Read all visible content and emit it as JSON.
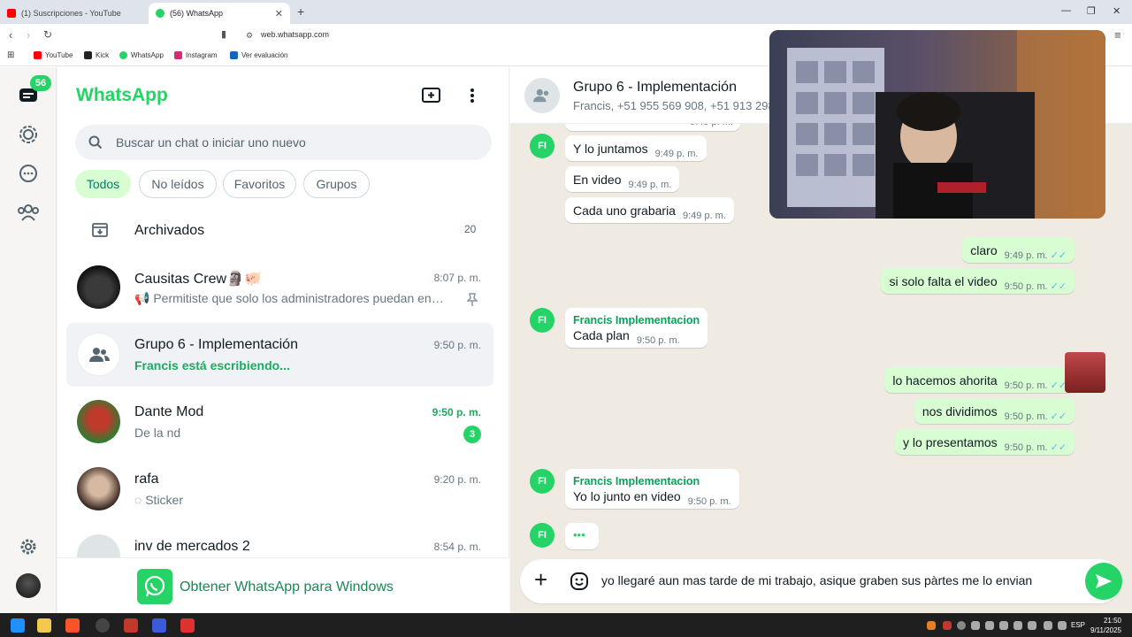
{
  "browser": {
    "tabs": [
      {
        "title": "(1) Suscripciones - YouTube",
        "active": false
      },
      {
        "title": "(56) WhatsApp",
        "active": true
      }
    ],
    "url": "web.whatsapp.com",
    "bookmarks": [
      "YouTube",
      "Kick",
      "WhatsApp",
      "Instagram",
      "Ver evaluación"
    ]
  },
  "rail": {
    "chats_badge": "56"
  },
  "sidebar": {
    "title": "WhatsApp",
    "search_placeholder": "Buscar un chat o iniciar uno nuevo",
    "filters": [
      "Todos",
      "No leídos",
      "Favoritos",
      "Grupos"
    ],
    "archived": {
      "label": "Archivados",
      "count": "20"
    },
    "chats": [
      {
        "name": "Causitas Crew🗿🐖",
        "time": "8:07 p. m.",
        "preview": "📢 Permitiste que solo los administradores puedan enviar...",
        "pinned": true
      },
      {
        "name": "Grupo 6 - Implementación",
        "time": "9:50 p. m.",
        "preview": "Francis está escribiendo..."
      },
      {
        "name": "Dante Mod",
        "time": "9:50 p. m.",
        "preview": "De la nd",
        "unread": "3"
      },
      {
        "name": "rafa",
        "time": "9:20 p. m.",
        "preview": "Sticker"
      },
      {
        "name": "inv de mercados 2",
        "time": "8:54 p. m.",
        "preview": ""
      }
    ],
    "get_app": "Obtener WhatsApp para Windows"
  },
  "conversation": {
    "name": "Grupo 6 - Implementación",
    "members": "Francis, +51 955 569 908, +51 913 298",
    "messages": [
      {
        "dir": "in",
        "text": "Y lo juntamos",
        "time": "9:49 p. m."
      },
      {
        "dir": "in",
        "text": "En video",
        "time": "9:49 p. m."
      },
      {
        "dir": "in",
        "text": "Cada uno grabaria",
        "time": "9:49 p. m."
      },
      {
        "dir": "out",
        "text": "claro",
        "time": "9:49 p. m."
      },
      {
        "dir": "out",
        "text": "si solo falta el video",
        "time": "9:50 p. m."
      },
      {
        "dir": "in",
        "sender": "Francis Implementacion",
        "text": "Cada plan",
        "time": "9:50 p. m."
      },
      {
        "dir": "out",
        "text": "lo hacemos ahorita",
        "time": "9:50 p. m."
      },
      {
        "dir": "out",
        "text": "nos dividimos",
        "time": "9:50 p. m."
      },
      {
        "dir": "out",
        "text": "y lo presentamos",
        "time": "9:50 p. m."
      },
      {
        "dir": "in",
        "sender": "Francis Implementacion",
        "text": "Yo lo junto en video",
        "time": "9:50 p. m."
      }
    ],
    "avatar_initials": "FI",
    "typing_dots": "•••",
    "draft": "yo llegaré aun mas tarde de mi trabajo, asique graben sus pàrtes me lo envian"
  },
  "taskbar": {
    "time": "21:50",
    "date": "9/11/2025",
    "lang": "ESP"
  },
  "colors": {
    "brand": "#25d366",
    "outgoing": "#d9fdd3",
    "chat_bg": "#efeae2"
  }
}
